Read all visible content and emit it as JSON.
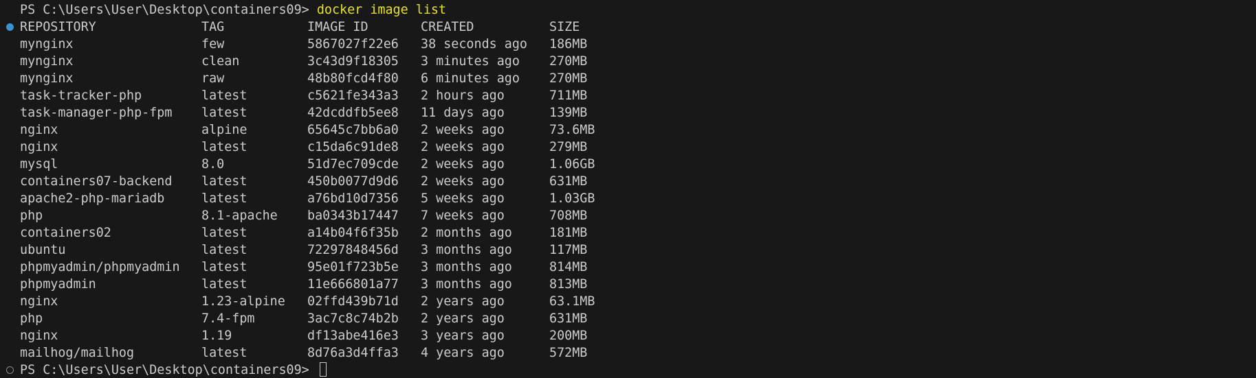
{
  "colors": {
    "background": "#181818",
    "foreground": "#cccccc",
    "command": "#e5e510",
    "decoration_active": "#3794d0",
    "decoration_idle": "#8a8a8a"
  },
  "prompt": {
    "path": "PS C:\\Users\\User\\Desktop\\containers09> ",
    "command": "docker image list"
  },
  "headers": {
    "repository": "REPOSITORY",
    "tag": "TAG",
    "image_id": "IMAGE ID",
    "created": "CREATED",
    "size": "SIZE"
  },
  "rows": [
    {
      "repository": "mynginx",
      "tag": "few",
      "image_id": "5867027f22e6",
      "created": "38 seconds ago",
      "size": "186MB"
    },
    {
      "repository": "mynginx",
      "tag": "clean",
      "image_id": "3c43d9f18305",
      "created": "3 minutes ago",
      "size": "270MB"
    },
    {
      "repository": "mynginx",
      "tag": "raw",
      "image_id": "48b80fcd4f80",
      "created": "6 minutes ago",
      "size": "270MB"
    },
    {
      "repository": "task-tracker-php",
      "tag": "latest",
      "image_id": "c5621fe343a3",
      "created": "2 hours ago",
      "size": "711MB"
    },
    {
      "repository": "task-manager-php-fpm",
      "tag": "latest",
      "image_id": "42dcddfb5ee8",
      "created": "11 days ago",
      "size": "139MB"
    },
    {
      "repository": "nginx",
      "tag": "alpine",
      "image_id": "65645c7bb6a0",
      "created": "2 weeks ago",
      "size": "73.6MB"
    },
    {
      "repository": "nginx",
      "tag": "latest",
      "image_id": "c15da6c91de8",
      "created": "2 weeks ago",
      "size": "279MB"
    },
    {
      "repository": "mysql",
      "tag": "8.0",
      "image_id": "51d7ec709cde",
      "created": "2 weeks ago",
      "size": "1.06GB"
    },
    {
      "repository": "containers07-backend",
      "tag": "latest",
      "image_id": "450b0077d9d6",
      "created": "2 weeks ago",
      "size": "631MB"
    },
    {
      "repository": "apache2-php-mariadb",
      "tag": "latest",
      "image_id": "a76bd10d7356",
      "created": "5 weeks ago",
      "size": "1.03GB"
    },
    {
      "repository": "php",
      "tag": "8.1-apache",
      "image_id": "ba0343b17447",
      "created": "7 weeks ago",
      "size": "708MB"
    },
    {
      "repository": "containers02",
      "tag": "latest",
      "image_id": "a14b04f6f35b",
      "created": "2 months ago",
      "size": "181MB"
    },
    {
      "repository": "ubuntu",
      "tag": "latest",
      "image_id": "72297848456d",
      "created": "3 months ago",
      "size": "117MB"
    },
    {
      "repository": "phpmyadmin/phpmyadmin",
      "tag": "latest",
      "image_id": "95e01f723b5e",
      "created": "3 months ago",
      "size": "814MB"
    },
    {
      "repository": "phpmyadmin",
      "tag": "latest",
      "image_id": "11e666801a77",
      "created": "3 months ago",
      "size": "813MB"
    },
    {
      "repository": "nginx",
      "tag": "1.23-alpine",
      "image_id": "02ffd439b71d",
      "created": "2 years ago",
      "size": "63.1MB"
    },
    {
      "repository": "php",
      "tag": "7.4-fpm",
      "image_id": "3ac7c8c74b2b",
      "created": "2 years ago",
      "size": "631MB"
    },
    {
      "repository": "nginx",
      "tag": "1.19",
      "image_id": "df13abe416e3",
      "created": "3 years ago",
      "size": "200MB"
    },
    {
      "repository": "mailhog/mailhog",
      "tag": "latest",
      "image_id": "8d76a3d4ffa3",
      "created": "4 years ago",
      "size": "572MB"
    }
  ],
  "prompt_end": {
    "path": "PS C:\\Users\\User\\Desktop\\containers09> "
  }
}
